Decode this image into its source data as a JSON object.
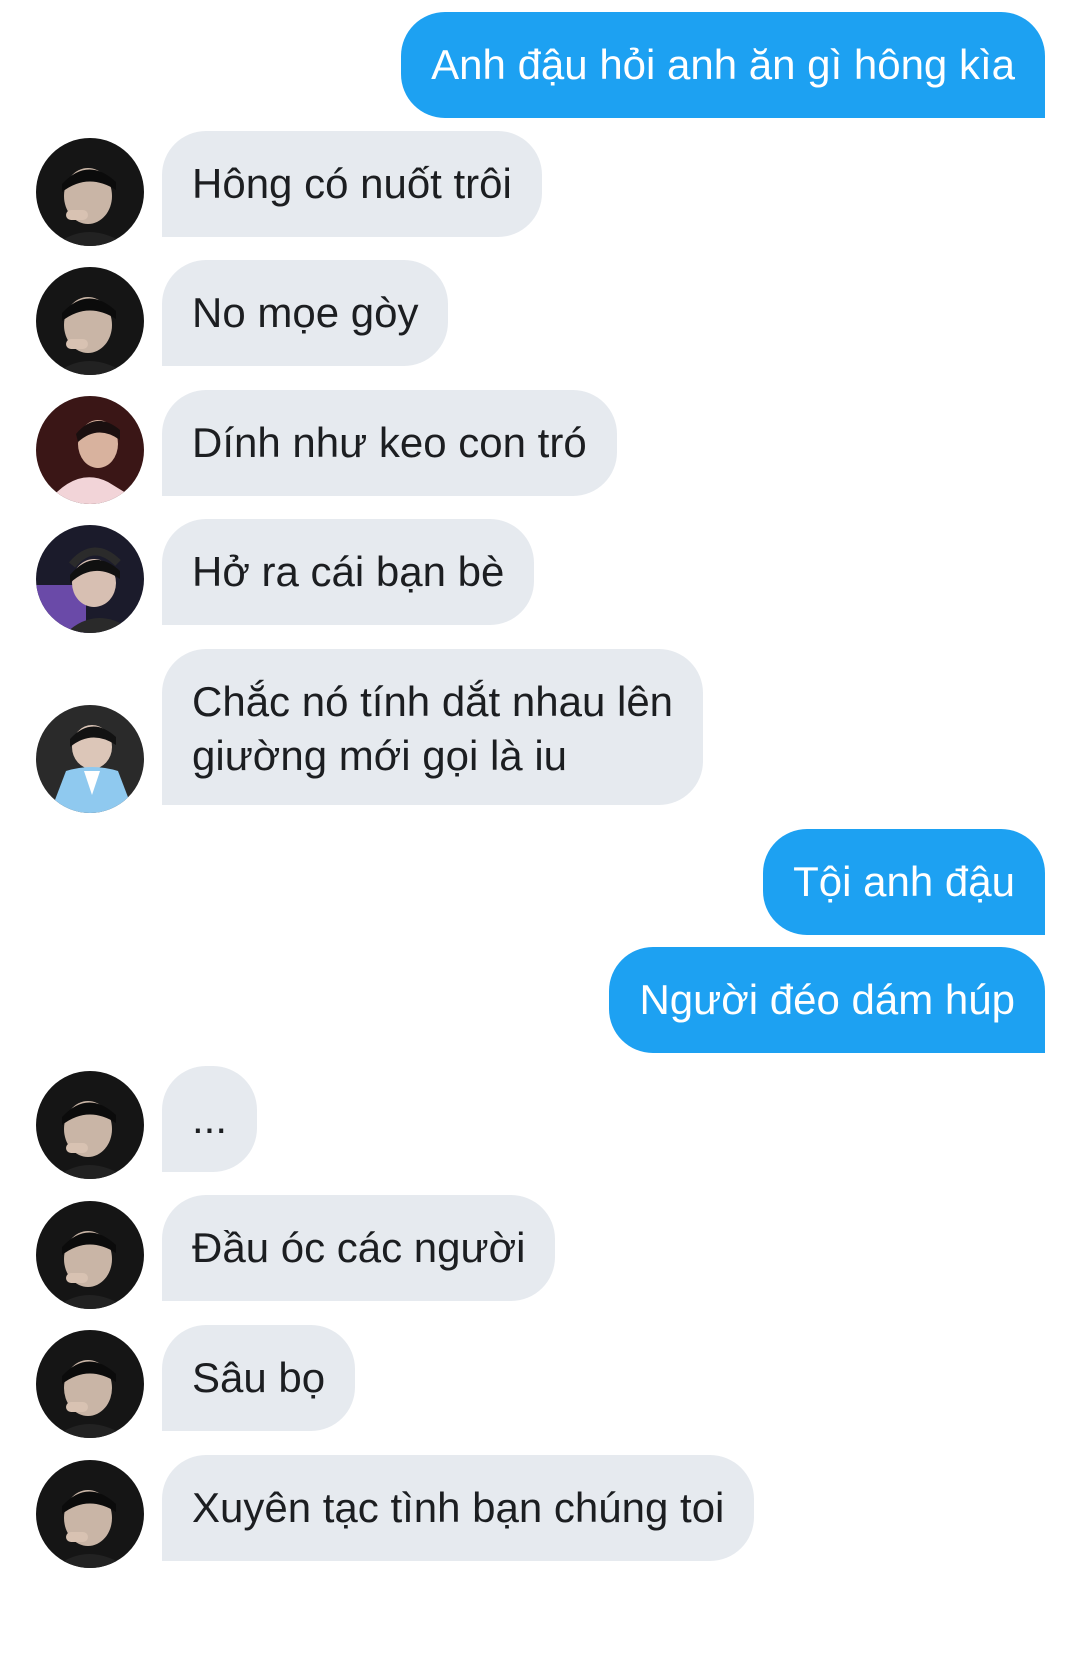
{
  "messages": [
    {
      "id": "m1",
      "side": "out",
      "text": "Anh đậu hỏi anh ăn gì hông kìa"
    },
    {
      "id": "m2",
      "side": "in",
      "avatar": "dark-profile-avatar",
      "text": "Hông có nuốt trôi"
    },
    {
      "id": "m3",
      "side": "in",
      "avatar": "dark-profile-avatar",
      "text": "No mọe gòy"
    },
    {
      "id": "m4",
      "side": "in",
      "avatar": "red-profile-avatar",
      "text": "Dính như keo con tró"
    },
    {
      "id": "m5",
      "side": "in",
      "avatar": "headphones-profile-avatar",
      "text": "Hở ra cái bạn bè"
    },
    {
      "id": "m6",
      "side": "in",
      "avatar": "blue-hanbok-profile-avatar",
      "text": "Chắc nó tính dắt nhau lên\ngiường mới gọi là iu"
    },
    {
      "id": "m7",
      "side": "out",
      "text": "Tội anh đậu"
    },
    {
      "id": "m8",
      "side": "out",
      "text": "Người đéo dám húp"
    },
    {
      "id": "m9",
      "side": "in",
      "avatar": "dark-profile-avatar",
      "text": "..."
    },
    {
      "id": "m10",
      "side": "in",
      "avatar": "dark-profile-avatar",
      "text": "Đầu óc các người"
    },
    {
      "id": "m11",
      "side": "in",
      "avatar": "dark-profile-avatar",
      "text": "Sâu bọ"
    },
    {
      "id": "m12",
      "side": "in",
      "avatar": "dark-profile-avatar",
      "text": "Xuyên tạc tình bạn chúng toi"
    }
  ],
  "colors": {
    "outgoing_bubble": "#1da1f2",
    "incoming_bubble": "#e6eaef",
    "outgoing_text": "#ffffff",
    "incoming_text": "#1c1e21"
  }
}
